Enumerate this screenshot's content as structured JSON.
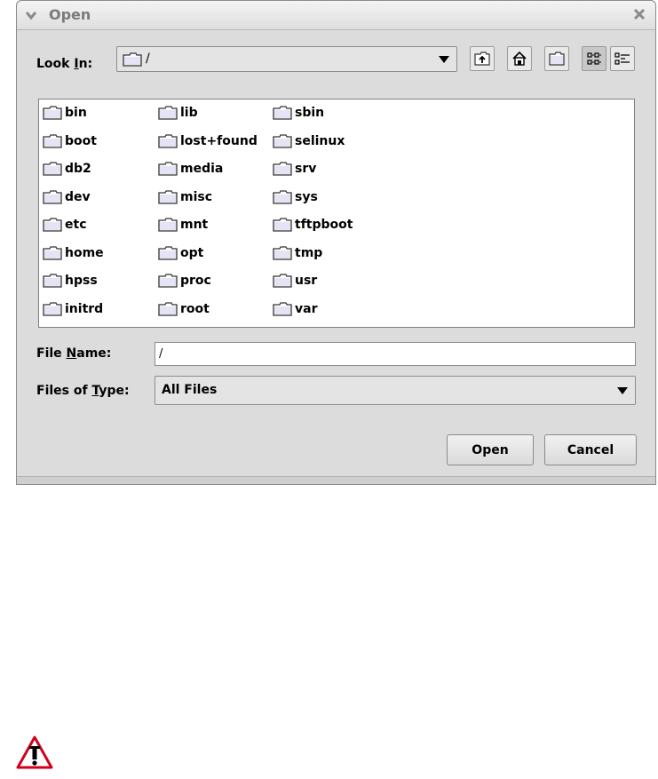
{
  "dialog": {
    "title": "Open",
    "look_in": {
      "label_pre": "Look ",
      "label_key": "I",
      "label_post": "n:",
      "value": "/"
    },
    "toolbar": [
      "up-one-level",
      "home",
      "new-folder",
      "list-view",
      "details-view"
    ],
    "files": [
      [
        "bin",
        "boot",
        "db2",
        "dev",
        "etc",
        "home",
        "hpss",
        "initrd"
      ],
      [
        "lib",
        "lost+found",
        "media",
        "misc",
        "mnt",
        "opt",
        "proc",
        "root"
      ],
      [
        "sbin",
        "selinux",
        "srv",
        "sys",
        "tftpboot",
        "tmp",
        "usr",
        "var"
      ]
    ],
    "file_name": {
      "label_pre": "File ",
      "label_key": "N",
      "label_post": "ame:",
      "value": "/"
    },
    "files_of_type": {
      "label_pre": "Files of ",
      "label_key": "T",
      "label_post": "ype:",
      "value": "All Files"
    },
    "buttons": {
      "open": "Open",
      "cancel": "Cancel"
    }
  }
}
